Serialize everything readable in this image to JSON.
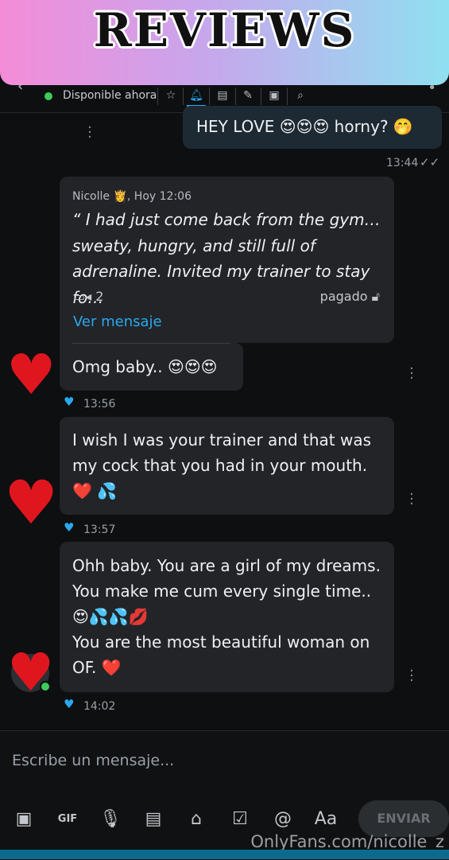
{
  "banner": {
    "title": "REVIEWS"
  },
  "header": {
    "status": "Disponible ahora",
    "icons": [
      "star-icon",
      "bell-icon",
      "note-icon",
      "pin-icon",
      "image-icon",
      "search-icon"
    ]
  },
  "messages": {
    "outgoing": {
      "text": "HEY LOVE 😍😍😍 horny? 🤭",
      "time": "13:44"
    },
    "quote": {
      "author": "Nicolle 👸",
      "date": ", Hoy 12:06",
      "text": "“ I had just come back from the gym… sweaty, hungry, and still full of adrenaline. Invited my trainer to stay fo…",
      "video_count": "2",
      "paid_label": "pagado",
      "link": "Ver mensaje"
    },
    "reply1": {
      "text": "Omg baby.. 😍😍😍",
      "time": "13:56"
    },
    "reply2": {
      "text": "I wish I was your trainer and that was my cock that you had in your mouth. ❤️ 💦",
      "time": "13:57"
    },
    "reply3": {
      "line1": "Ohh baby. You are a girl of my dreams.",
      "line2": "You make me cum every single time..",
      "line3": "😍💦💦💋",
      "line4": "You are the most beautiful woman on",
      "line5": "OF. ❤️",
      "time": "14:02"
    }
  },
  "composer": {
    "placeholder": "Escribe un mensaje...",
    "send_label": "ENVIAR",
    "font_label": "Aa",
    "gif_label": "GIF"
  },
  "watermark": "OnlyFans.com/nicolle_z",
  "colors": {
    "accent": "#2aa8ee",
    "heart": "#e0161f",
    "online": "#3dcb5b"
  }
}
